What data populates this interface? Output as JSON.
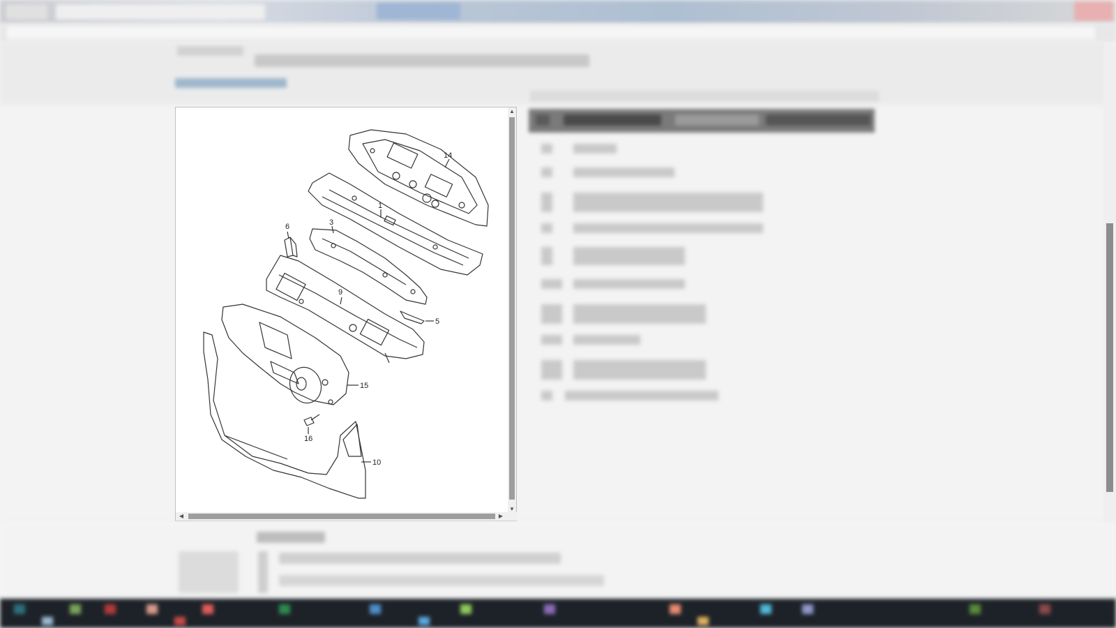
{
  "diagram": {
    "callouts": [
      "14",
      "1",
      "3",
      "6",
      "9",
      "5",
      "15",
      "16",
      "10"
    ]
  },
  "scrollbars": {
    "up_arrow": "▲",
    "down_arrow": "▼",
    "left_arrow": "◀",
    "right_arrow": "▶"
  },
  "colors": {
    "taskbar": "#1d2228",
    "header": "#7a7a7a",
    "link": "#9fb8cc"
  }
}
